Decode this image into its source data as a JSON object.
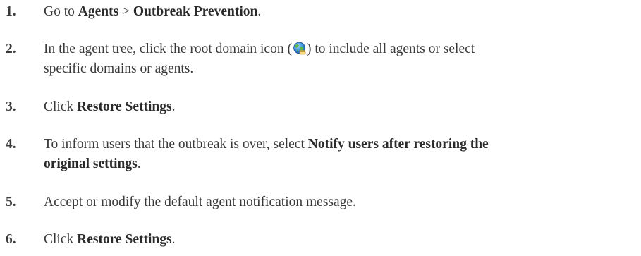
{
  "steps": [
    {
      "number": "1.",
      "parts": {
        "a": "Go to ",
        "b": "Agents",
        "c": " > ",
        "d": "Outbreak Prevention",
        "e": "."
      }
    },
    {
      "number": "2.",
      "parts": {
        "a": "In the agent tree, click the root domain icon (",
        "icon": "root-domain-globe-icon",
        "b": ") to include all agents or select",
        "c": "specific domains or agents."
      }
    },
    {
      "number": "3.",
      "parts": {
        "a": "Click ",
        "b": "Restore Settings",
        "c": "."
      }
    },
    {
      "number": "4.",
      "parts": {
        "a": "To inform users that the outbreak is over, select ",
        "b": "Notify users after restoring the",
        "c": "original settings",
        "d": "."
      }
    },
    {
      "number": "5.",
      "parts": {
        "a": "Accept or modify the default agent notification message."
      }
    },
    {
      "number": "6.",
      "parts": {
        "a": "Click ",
        "b": "Restore Settings",
        "c": "."
      }
    }
  ]
}
